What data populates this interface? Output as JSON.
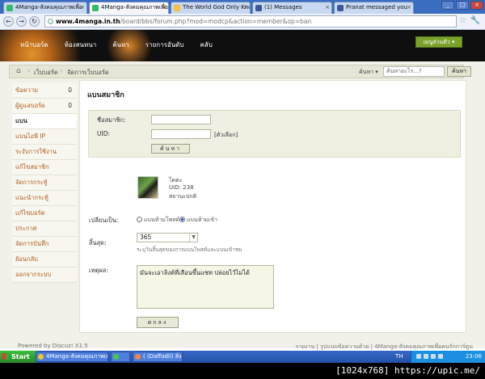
{
  "browser": {
    "tabs": [
      {
        "label": "4Manga-สังคมคุณภาพเพื่อ",
        "active": false
      },
      {
        "label": "4Manga-สังคมคุณภาพเพื่อ",
        "active": true
      },
      {
        "label": "The World God Only Know",
        "active": false
      },
      {
        "label": "(1) Messages",
        "active": false
      },
      {
        "label": "Pranat messaged you",
        "active": false
      }
    ],
    "url_host": "www.4manga.in.th",
    "url_path": "/board/bbs/forum.php?mod=modcp&action=member&op=ban"
  },
  "site": {
    "nav": [
      "หน้าบอร์ด",
      "ห้องสนทนา",
      "ค้นหา",
      "รายการอันดับ",
      "คลับ"
    ],
    "quick_button": "เมนูส่วนตัว"
  },
  "breadcrumb": {
    "items": [
      "เว็บบอร์ด",
      "จัดการเว็บบอร์ด"
    ],
    "search_label": "ค้นหา",
    "search_placeholder": "ค้นหาอะไร...?",
    "search_button": "ค้นหา"
  },
  "sidebar": {
    "items": [
      {
        "label": "ข้อความ",
        "count": "0",
        "active": false
      },
      {
        "label": "ผู้ดูแลบอร์ด",
        "count": "0",
        "active": false
      },
      {
        "label": "แบน",
        "count": "",
        "active": true
      },
      {
        "label": "แบนไอพี IP",
        "count": "",
        "active": false
      },
      {
        "label": "ระงับการใช้งาน",
        "count": "",
        "active": false
      },
      {
        "label": "แก้ไขสมาชิก",
        "count": "",
        "active": false
      },
      {
        "label": "จัดการกระทู้",
        "count": "",
        "active": false
      },
      {
        "label": "แนะนำกระทู้",
        "count": "",
        "active": false
      },
      {
        "label": "แก้ไขบอร์ด",
        "count": "",
        "active": false
      },
      {
        "label": "ประกาศ",
        "count": "",
        "active": false
      },
      {
        "label": "จัดการบันทึก",
        "count": "",
        "active": false
      },
      {
        "label": "ย้อนกลับ",
        "count": "",
        "active": false
      },
      {
        "label": "ออกจากระบบ",
        "count": "",
        "active": false
      }
    ]
  },
  "main": {
    "title": "แบนสมาชิก",
    "username_label": "ชื่อสมาชิก:",
    "username_value": "",
    "uid_label": "UID:",
    "uid_value": "",
    "uid_hint": "[ตัวเลือก]",
    "search_button": "ค้นหา",
    "user_name": "ไดตะ",
    "user_uid": "UID: 238",
    "user_status": "สถานะปกติ",
    "change_label": "เปลี่ยนเป็น:",
    "option_ban_post": "แบนห้ามโพสต์",
    "option_ban_access": "แบนห้ามเข้า",
    "selected_option": "ban_access",
    "expiry_label": "สิ้นสุด:",
    "expiry_value": "365",
    "expiry_hint": "ระบุวันสิ้นสุดของการแบนโพสต์และแบนเข้าชม",
    "reason_label": "เหตุผล:",
    "reason_value": "มันจะเอาลิงค์ที่เลือนขึ้นแชท ปล่อยไว้ไม่ได้",
    "submit_button": "ตกลง"
  },
  "footer": {
    "left": "Powered by Discuz! X1.5",
    "right": "รายงาน | รูปแบบข้อความด้วย | 4Manga-สังคมคุณภาพเพื่อคนรักการ์ตูน"
  },
  "taskbar": {
    "start": "Start",
    "tasks": [
      "4Manga-สังคมคุณภาพเพ...",
      "",
      "( (Daffodil) สิ่งเ..."
    ],
    "lang": "TH",
    "time": "23:06"
  },
  "caption": "[1024x768] https://upic.me/"
}
